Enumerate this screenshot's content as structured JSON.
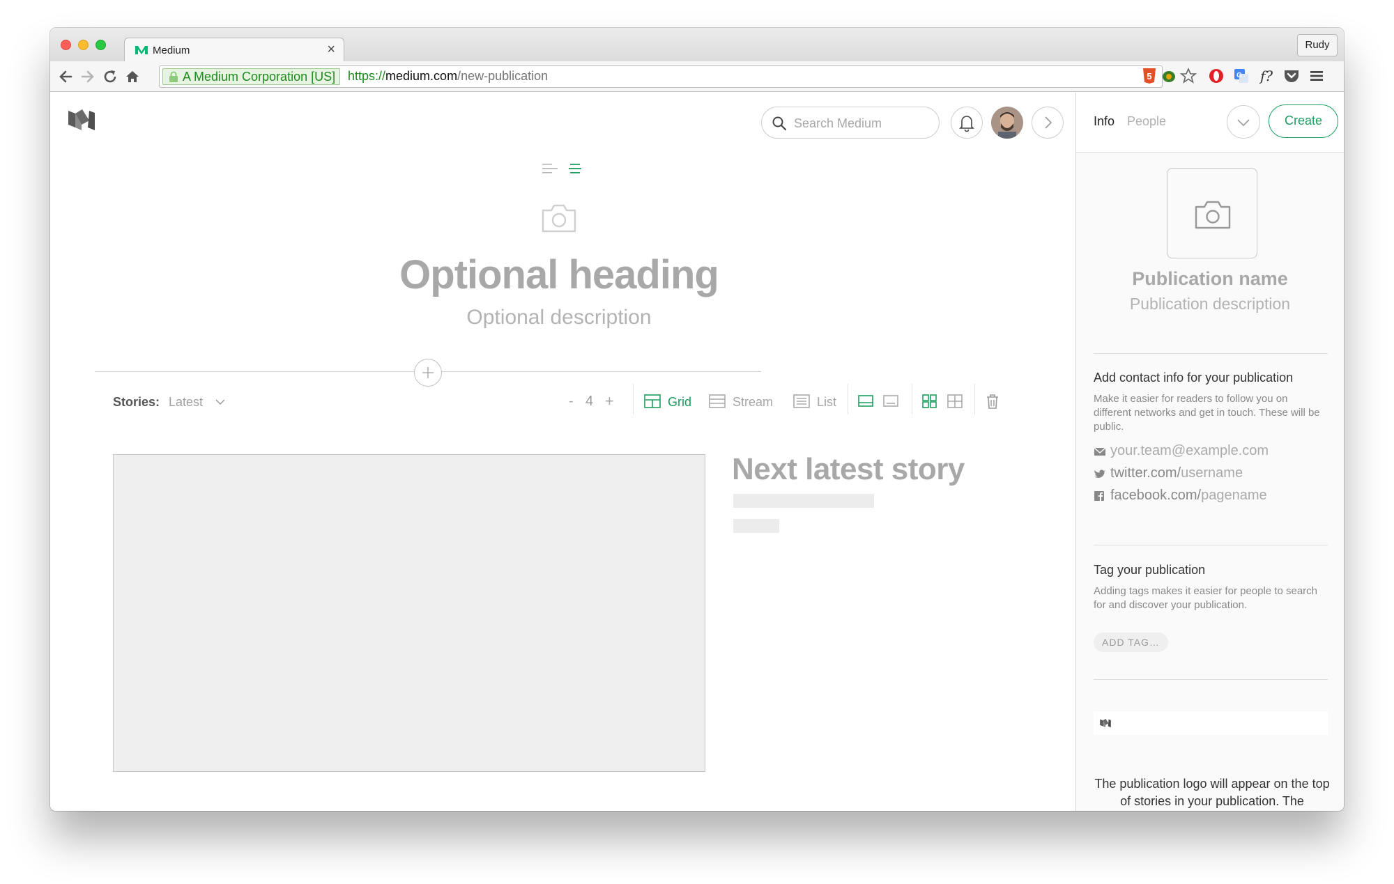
{
  "browser": {
    "tab_title": "Medium",
    "tab_close": "×",
    "profile_name": "Rudy",
    "ev_label": "A Medium Corporation [US]",
    "url_scheme": "https://",
    "url_host": "medium.com",
    "url_path": "/new-publication"
  },
  "header": {
    "search_placeholder": "Search Medium"
  },
  "editor": {
    "heading": "Optional heading",
    "description": "Optional description"
  },
  "stream_bar": {
    "stories_label": "Stories:",
    "stories_value": "Latest",
    "count_minus": "-",
    "count": "4",
    "count_plus": "+",
    "layouts": [
      {
        "label": "Grid",
        "active": true
      },
      {
        "label": "Stream",
        "active": false
      },
      {
        "label": "List",
        "active": false
      }
    ]
  },
  "story": {
    "title": "Next latest story"
  },
  "sidebar": {
    "tabs": {
      "info": "Info",
      "people": "People"
    },
    "create_label": "Create",
    "pub_name": "Publication name",
    "pub_description": "Publication description",
    "contact": {
      "title": "Add contact info for your publication",
      "text": "Make it easier for readers to follow you on different networks and get in touch. These will be public.",
      "email_placeholder": "your.team@example.com",
      "twitter_prefix": "twitter.com/",
      "twitter_placeholder": "username",
      "facebook_prefix": "facebook.com/",
      "facebook_placeholder": "pagename"
    },
    "tags": {
      "title": "Tag your publication",
      "text": "Adding tags makes it easier for people to search for and discover your publication.",
      "add_tag": "ADD TAG…"
    },
    "logo_note": "The publication logo will appear on the top of stories in your publication. The"
  },
  "colors": {
    "accent": "#1c9e5f",
    "placeholder_text": "#a8a8a8",
    "image_placeholder": "#efefef"
  },
  "icons": [
    "search-icon",
    "bell-icon",
    "chevron-right-icon",
    "chevron-down-icon",
    "camera-icon",
    "plus-icon",
    "grid-icon",
    "stream-icon",
    "list-icon",
    "trash-icon",
    "mail-icon",
    "twitter-icon",
    "facebook-icon",
    "medium-logo"
  ]
}
